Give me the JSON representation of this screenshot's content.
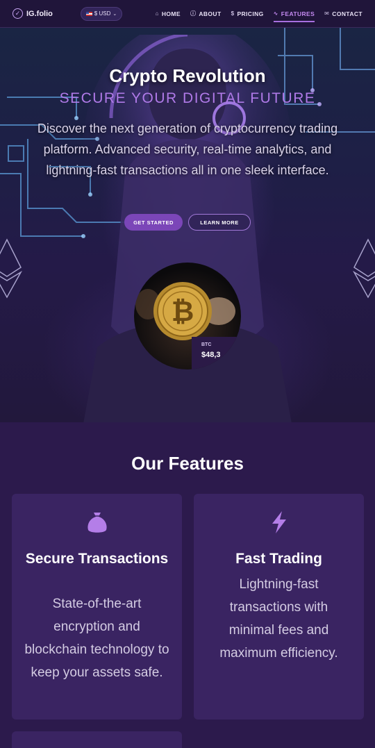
{
  "nav": {
    "brand": "IG.folio",
    "currency": "$ USD",
    "items": [
      {
        "label": "HOME",
        "icon": "home-icon"
      },
      {
        "label": "ABOUT",
        "icon": "info-icon"
      },
      {
        "label": "PRICING",
        "icon": "dollar-icon"
      },
      {
        "label": "FEATURES",
        "icon": "pulse-icon",
        "active": true
      },
      {
        "label": "CONTACT",
        "icon": "mail-icon"
      }
    ]
  },
  "hero": {
    "title": "Crypto Revolution",
    "subtitle": "SECURE YOUR DIGITAL FUTURE",
    "description": "Discover the next generation of cryptocurrency trading platform. Advanced security, real-time analytics, and lightning-fast transactions all in one sleek interface.",
    "primary_button": "GET STARTED",
    "secondary_button": "LEARN MORE",
    "ticker": {
      "symbol": "BTC",
      "price": "$48,3"
    }
  },
  "features": {
    "title": "Our Features",
    "cards": [
      {
        "icon": "money-bag-icon",
        "title": "Secure Transactions",
        "description": "State-of-the-art encryption and blockchain technology to keep your assets safe."
      },
      {
        "icon": "lightning-icon",
        "title": "Fast Trading",
        "description": "Lightning-fast transactions with minimal fees and maximum efficiency."
      }
    ]
  },
  "colors": {
    "accent": "#a86fe0",
    "background": "#2c1a4c",
    "card": "#3a2462"
  }
}
